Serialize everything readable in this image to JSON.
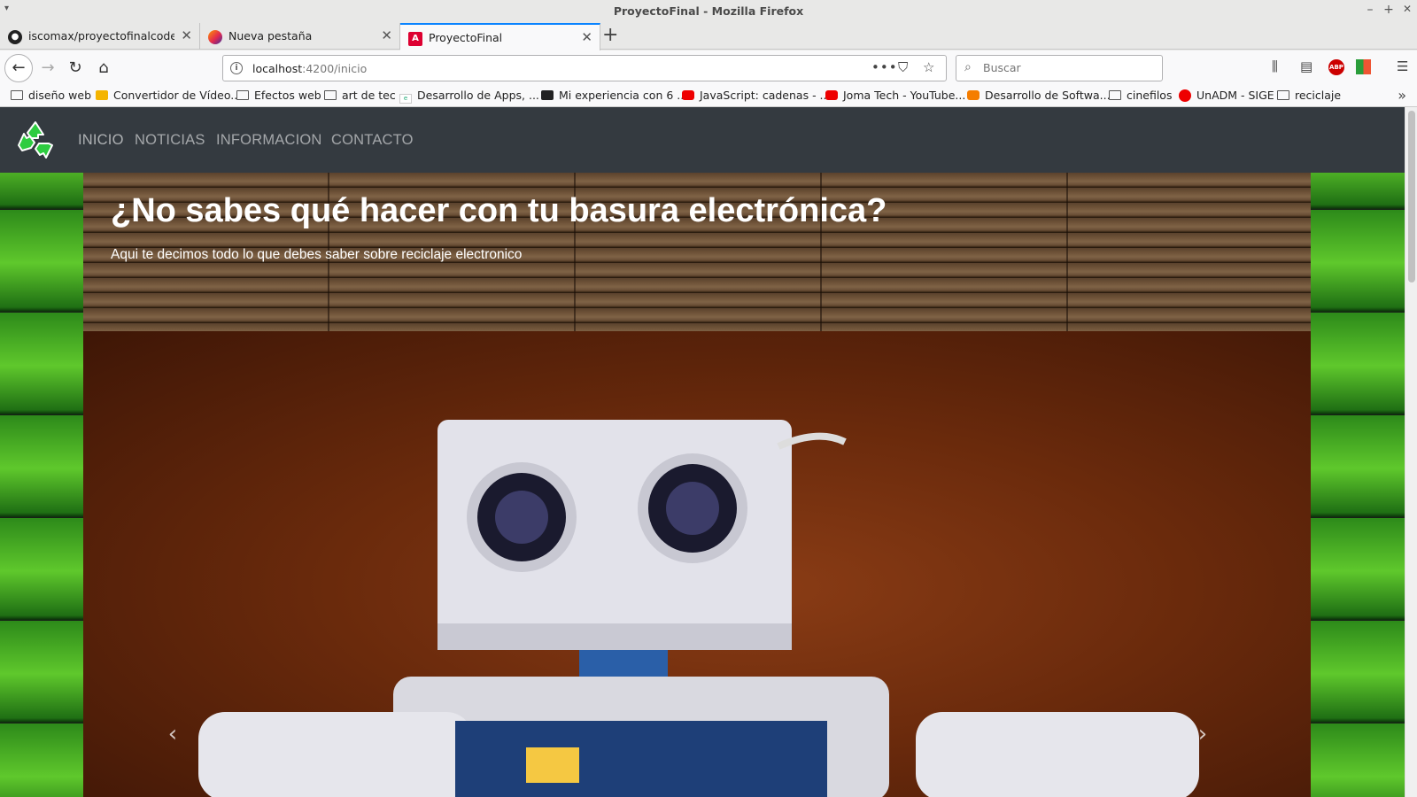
{
  "window": {
    "title": "ProyectoFinal - Mozilla Firefox",
    "controls": [
      "–",
      "+",
      "✕"
    ]
  },
  "tabs": [
    {
      "label": "iscomax/proyectofinalcodeando",
      "icon": "github-icon",
      "active": false
    },
    {
      "label": "Nueva pestaña",
      "icon": "firefox-icon",
      "active": false
    },
    {
      "label": "ProyectoFinal",
      "icon": "angular-icon",
      "active": true
    }
  ],
  "urlbar": {
    "host": "localhost",
    "path": ":4200/inicio"
  },
  "search": {
    "placeholder": "Buscar"
  },
  "bookmarks": [
    {
      "label": "diseño web",
      "icon": "folder-icon"
    },
    {
      "label": "Convertidor de Vídeo...",
      "icon": "converter-icon"
    },
    {
      "label": "Efectos web",
      "icon": "folder-icon"
    },
    {
      "label": "art de tec",
      "icon": "folder-icon"
    },
    {
      "label": "Desarrollo de Apps, ...",
      "icon": "eo-icon"
    },
    {
      "label": "Mi experiencia con 6 ...",
      "icon": "medium-icon"
    },
    {
      "label": "JavaScript: cadenas - ...",
      "icon": "youtube-icon"
    },
    {
      "label": "Joma Tech - YouTube...",
      "icon": "youtube-icon"
    },
    {
      "label": "Desarrollo de Softwa...",
      "icon": "blogger-icon"
    },
    {
      "label": "cinefilos",
      "icon": "folder-icon"
    },
    {
      "label": "UnADM - SIGE",
      "icon": "red-dot-icon"
    },
    {
      "label": "reciclaje",
      "icon": "folder-icon"
    }
  ],
  "site": {
    "nav": [
      "INICIO",
      "NOTICIAS",
      "INFORMACION",
      "CONTACTO"
    ],
    "jumbotron": {
      "title": "¿No sabes qué hacer con tu basura electrónica?",
      "subtitle": "Aqui te decimos todo lo que debes saber sobre reciclaje electronico"
    },
    "carousel": {
      "prev": "‹",
      "next": "›"
    }
  },
  "colors": {
    "accent": "#0a84ff",
    "site_nav": "#343a40",
    "green_bg": "#5fc82c"
  }
}
